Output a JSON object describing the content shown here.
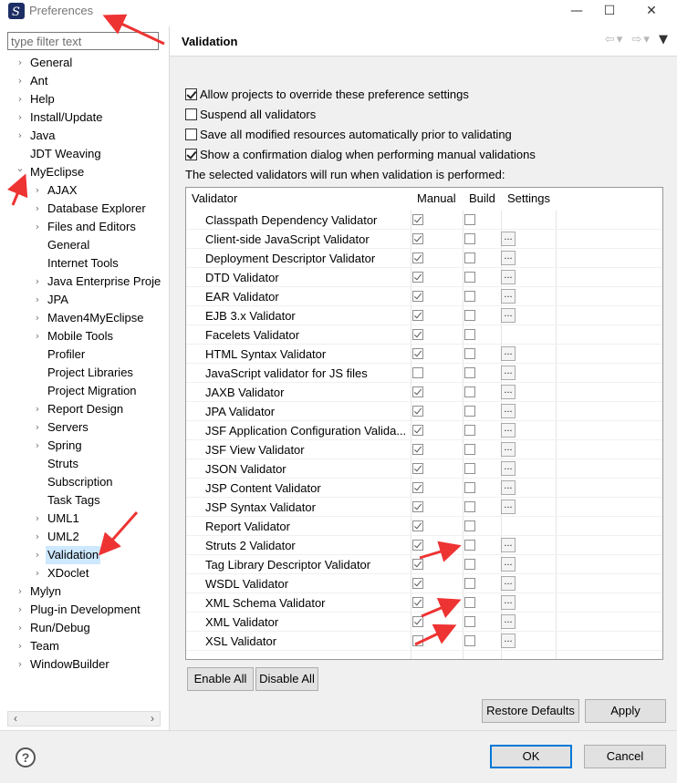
{
  "window": {
    "title": "Preferences",
    "minimize_glyph": "—",
    "maximize_glyph": "☐",
    "close_glyph": "✕"
  },
  "filter": {
    "placeholder": "type filter text"
  },
  "tree": [
    {
      "label": "General",
      "level": 0,
      "expander": "collapsed"
    },
    {
      "label": "Ant",
      "level": 0,
      "expander": "collapsed"
    },
    {
      "label": "Help",
      "level": 0,
      "expander": "collapsed"
    },
    {
      "label": "Install/Update",
      "level": 0,
      "expander": "collapsed"
    },
    {
      "label": "Java",
      "level": 0,
      "expander": "collapsed"
    },
    {
      "label": "JDT Weaving",
      "level": 0,
      "expander": "none"
    },
    {
      "label": "MyEclipse",
      "level": 0,
      "expander": "expanded"
    },
    {
      "label": "AJAX",
      "level": 1,
      "expander": "collapsed"
    },
    {
      "label": "Database Explorer",
      "level": 1,
      "expander": "collapsed"
    },
    {
      "label": "Files and Editors",
      "level": 1,
      "expander": "collapsed"
    },
    {
      "label": "General",
      "level": 1,
      "expander": "none"
    },
    {
      "label": "Internet Tools",
      "level": 1,
      "expander": "none"
    },
    {
      "label": "Java Enterprise Proje",
      "level": 1,
      "expander": "collapsed"
    },
    {
      "label": "JPA",
      "level": 1,
      "expander": "collapsed"
    },
    {
      "label": "Maven4MyEclipse",
      "level": 1,
      "expander": "collapsed"
    },
    {
      "label": "Mobile Tools",
      "level": 1,
      "expander": "collapsed"
    },
    {
      "label": "Profiler",
      "level": 1,
      "expander": "none"
    },
    {
      "label": "Project Libraries",
      "level": 1,
      "expander": "none"
    },
    {
      "label": "Project Migration",
      "level": 1,
      "expander": "none"
    },
    {
      "label": "Report Design",
      "level": 1,
      "expander": "collapsed"
    },
    {
      "label": "Servers",
      "level": 1,
      "expander": "collapsed"
    },
    {
      "label": "Spring",
      "level": 1,
      "expander": "collapsed"
    },
    {
      "label": "Struts",
      "level": 1,
      "expander": "none"
    },
    {
      "label": "Subscription",
      "level": 1,
      "expander": "none"
    },
    {
      "label": "Task Tags",
      "level": 1,
      "expander": "none"
    },
    {
      "label": "UML1",
      "level": 1,
      "expander": "collapsed"
    },
    {
      "label": "UML2",
      "level": 1,
      "expander": "collapsed"
    },
    {
      "label": "Validation",
      "level": 1,
      "expander": "collapsed",
      "selected": true
    },
    {
      "label": "XDoclet",
      "level": 1,
      "expander": "collapsed"
    },
    {
      "label": "Mylyn",
      "level": 0,
      "expander": "collapsed"
    },
    {
      "label": "Plug-in Development",
      "level": 0,
      "expander": "collapsed"
    },
    {
      "label": "Run/Debug",
      "level": 0,
      "expander": "collapsed"
    },
    {
      "label": "Team",
      "level": 0,
      "expander": "collapsed"
    },
    {
      "label": "WindowBuilder",
      "level": 0,
      "expander": "collapsed"
    }
  ],
  "page": {
    "title": "Validation",
    "options": [
      {
        "label": "Allow projects to override these preference settings",
        "checked": true
      },
      {
        "label": "Suspend all validators",
        "checked": false
      },
      {
        "label": "Save all modified resources automatically prior to validating",
        "checked": false
      },
      {
        "label": "Show a confirmation dialog when performing manual validations",
        "checked": true
      }
    ],
    "info": "The selected validators will run when validation is performed:",
    "columns": {
      "validator": "Validator",
      "manual": "Manual",
      "build": "Build",
      "settings": "Settings"
    },
    "settings_button_label": "...",
    "validators": [
      {
        "name": "Classpath Dependency Validator",
        "manual": true,
        "build": false,
        "settings": false
      },
      {
        "name": "Client-side JavaScript Validator",
        "manual": true,
        "build": false,
        "settings": true
      },
      {
        "name": "Deployment Descriptor Validator",
        "manual": true,
        "build": false,
        "settings": true
      },
      {
        "name": "DTD Validator",
        "manual": true,
        "build": false,
        "settings": true
      },
      {
        "name": "EAR Validator",
        "manual": true,
        "build": false,
        "settings": true
      },
      {
        "name": "EJB 3.x Validator",
        "manual": true,
        "build": false,
        "settings": true
      },
      {
        "name": "Facelets Validator",
        "manual": true,
        "build": false,
        "settings": false
      },
      {
        "name": "HTML Syntax Validator",
        "manual": true,
        "build": false,
        "settings": true
      },
      {
        "name": "JavaScript validator for JS files",
        "manual": false,
        "build": false,
        "settings": true
      },
      {
        "name": "JAXB Validator",
        "manual": true,
        "build": false,
        "settings": true
      },
      {
        "name": "JPA Validator",
        "manual": true,
        "build": false,
        "settings": true
      },
      {
        "name": "JSF Application Configuration Valida...",
        "manual": true,
        "build": false,
        "settings": true
      },
      {
        "name": "JSF View Validator",
        "manual": true,
        "build": false,
        "settings": true
      },
      {
        "name": "JSON Validator",
        "manual": true,
        "build": false,
        "settings": true
      },
      {
        "name": "JSP Content Validator",
        "manual": true,
        "build": false,
        "settings": true
      },
      {
        "name": "JSP Syntax Validator",
        "manual": true,
        "build": false,
        "settings": true
      },
      {
        "name": "Report Validator",
        "manual": true,
        "build": false,
        "settings": false
      },
      {
        "name": "Struts 2 Validator",
        "manual": true,
        "build": false,
        "settings": true
      },
      {
        "name": "Tag Library Descriptor Validator",
        "manual": true,
        "build": false,
        "settings": true
      },
      {
        "name": "WSDL Validator",
        "manual": true,
        "build": false,
        "settings": true
      },
      {
        "name": "XML Schema Validator",
        "manual": true,
        "build": false,
        "settings": true
      },
      {
        "name": "XML Validator",
        "manual": true,
        "build": false,
        "settings": true
      },
      {
        "name": "XSL Validator",
        "manual": false,
        "build": false,
        "settings": true
      }
    ],
    "enable_all": "Enable All",
    "disable_all": "Disable All",
    "restore_defaults": "Restore Defaults",
    "apply": "Apply"
  },
  "footer": {
    "help_glyph": "?",
    "ok": "OK",
    "cancel": "Cancel"
  },
  "colors": {
    "annotation_arrow": "#ee3333",
    "selection": "#cde8ff",
    "default_button_border": "#0078d7"
  }
}
